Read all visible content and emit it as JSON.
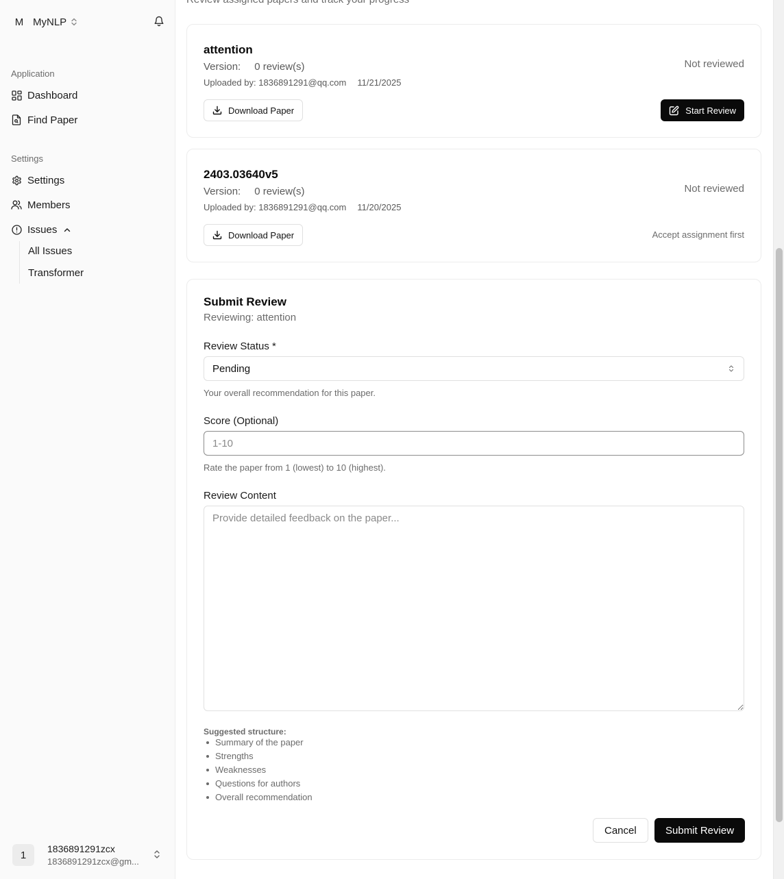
{
  "org": {
    "avatar": "M",
    "name": "MyNLP"
  },
  "sidebar": {
    "application_label": "Application",
    "application_items": [
      {
        "label": "Dashboard",
        "icon": "dashboard-icon"
      },
      {
        "label": "Find Paper",
        "icon": "file-search-icon"
      }
    ],
    "settings_label": "Settings",
    "settings_items": [
      {
        "label": "Settings",
        "icon": "gear-icon"
      },
      {
        "label": "Members",
        "icon": "users-icon"
      },
      {
        "label": "Issues",
        "icon": "alert-circle-icon"
      }
    ],
    "issues_sub": [
      "All Issues",
      "Transformer"
    ]
  },
  "user": {
    "avatar": "1",
    "name": "1836891291zcx",
    "email": "1836891291zcx@gm..."
  },
  "page_subtitle": "Review assigned papers and track your progress",
  "papers": [
    {
      "title": "attention",
      "version_label": "Version:",
      "reviews": "0 review(s)",
      "uploaded_by": "Uploaded by: 1836891291@qq.com",
      "date": "11/21/2025",
      "status": "Not reviewed",
      "download_label": "Download Paper",
      "action_label": "Start Review"
    },
    {
      "title": "2403.03640v5",
      "version_label": "Version:",
      "reviews": "0 review(s)",
      "uploaded_by": "Uploaded by: 1836891291@qq.com",
      "date": "11/20/2025",
      "status": "Not reviewed",
      "download_label": "Download Paper",
      "action_note": "Accept assignment first"
    }
  ],
  "review_form": {
    "title": "Submit Review",
    "subtitle": "Reviewing: attention",
    "status_label": "Review Status *",
    "status_value": "Pending",
    "status_help": "Your overall recommendation for this paper.",
    "score_label": "Score (Optional)",
    "score_placeholder": "1-10",
    "score_help": "Rate the paper from 1 (lowest) to 10 (highest).",
    "content_label": "Review Content",
    "content_placeholder": "Provide detailed feedback on the paper...",
    "suggested_heading": "Suggested structure:",
    "suggested_items": [
      "Summary of the paper",
      "Strengths",
      "Weaknesses",
      "Questions for authors",
      "Overall recommendation"
    ],
    "cancel_label": "Cancel",
    "submit_label": "Submit Review"
  }
}
